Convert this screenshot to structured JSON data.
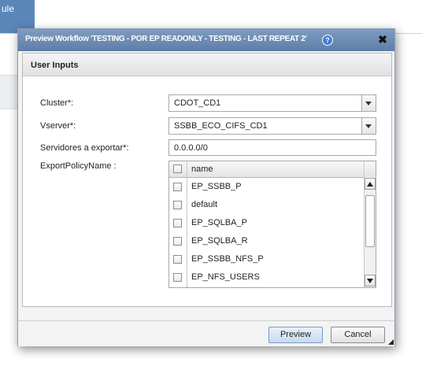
{
  "background": {
    "schedule_tab_fragment": "ule"
  },
  "dialog": {
    "title": "Preview Workflow 'TESTING - POR EP READONLY - TESTING - LAST REPEAT 2'",
    "help_glyph": "?",
    "close_glyph": "✖",
    "section_title": "User Inputs",
    "fields": {
      "cluster": {
        "label": "Cluster*:",
        "value": "CDOT_CD1"
      },
      "vserver": {
        "label": "Vserver*:",
        "value": "SSBB_ECO_CIFS_CD1"
      },
      "servidores": {
        "label": "Servidores a exportar*:",
        "value": "0.0.0.0/0"
      },
      "export_policy": {
        "label": "ExportPolicyName :"
      }
    },
    "grid": {
      "column_header": "name",
      "rows": [
        "EP_SSBB_P",
        "default",
        "EP_SQLBA_P",
        "EP_SQLBA_R",
        "EP_SSBB_NFS_P",
        "EP_NFS_USERS"
      ]
    },
    "buttons": {
      "preview": "Preview",
      "cancel": "Cancel"
    }
  },
  "colors": {
    "titlebar": "#6b8bb4",
    "schedule_tab": "#5b86b8",
    "preview_button": "#c8d9ee"
  }
}
